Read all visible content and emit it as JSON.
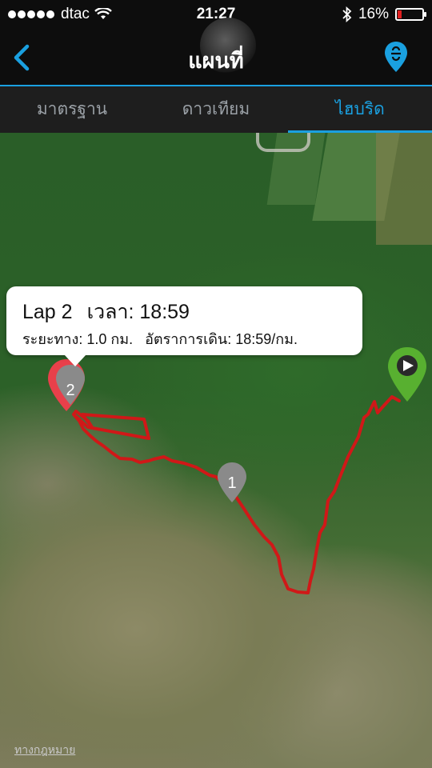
{
  "status_bar": {
    "carrier": "dtac",
    "time": "21:27",
    "battery": "16%",
    "battery_level": 0.16
  },
  "nav": {
    "title": "แผนที่"
  },
  "tabs": [
    {
      "label": "มาตรฐาน",
      "active": false
    },
    {
      "label": "ดาวเทียม",
      "active": false
    },
    {
      "label": "ไฮบริด",
      "active": true
    }
  ],
  "callout": {
    "lap": "Lap 2",
    "time_label": "เวลา: 18:59",
    "distance": "ระยะทาง: 1.0 กม.",
    "pace": "อัตราการเดิน: 18:59/กม."
  },
  "markers": {
    "lap1": "1",
    "lap2": "2"
  },
  "legal_link": "ทางกฎหมาย",
  "colors": {
    "accent": "#1aa0e0",
    "route": "#d01818",
    "start_marker": "#58b030",
    "lap_marker": "#888888",
    "selected_marker": "#e8404a"
  }
}
